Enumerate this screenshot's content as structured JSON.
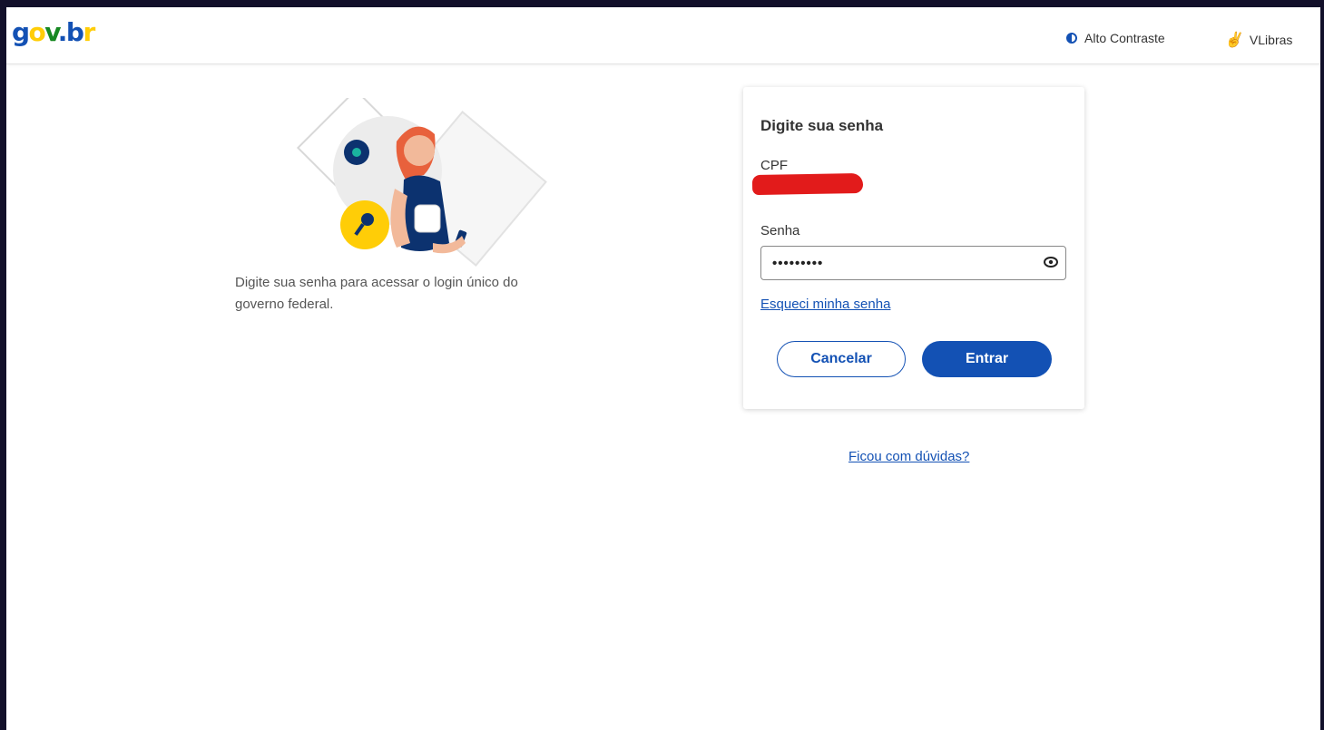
{
  "header": {
    "logo": {
      "g": "g",
      "o": "o",
      "v": "v",
      "dot": ".",
      "b": "b",
      "r": "r"
    },
    "contrast_label": "Alto Contraste",
    "vlibras_label": "VLibras"
  },
  "intro": {
    "text": "Digite sua senha para acessar o login único do governo federal."
  },
  "login_card": {
    "title": "Digite sua senha",
    "cpf_label": "CPF",
    "password_label": "Senha",
    "password_value": "•••••••••",
    "forgot_link": "Esqueci minha senha",
    "cancel_button": "Cancelar",
    "enter_button": "Entrar"
  },
  "help_link": "Ficou com dúvidas?",
  "colors": {
    "primary": "#1351b4",
    "yellow": "#ffcd07",
    "green": "#168821",
    "redaction": "#e21b1b"
  },
  "icons": [
    "contrast-icon",
    "vlibras-hand-icon",
    "eye-icon",
    "key-icon"
  ]
}
